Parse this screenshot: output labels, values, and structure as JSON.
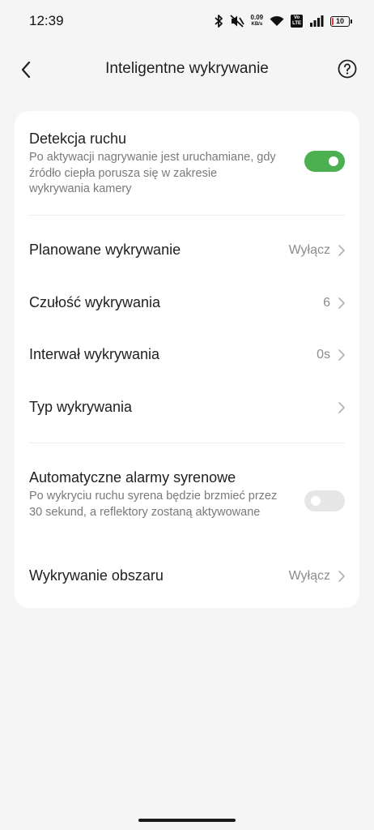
{
  "status_bar": {
    "time": "12:39",
    "net_speed": "0.09",
    "net_unit": "KB/s",
    "volte_top": "Vo",
    "volte_bottom": "LTE",
    "battery": "10",
    "battery_color": "#e53935",
    "battery_level": 0.1,
    "icons": [
      "bluetooth-icon",
      "mute-icon",
      "wifi-icon",
      "signal-icon",
      "battery-icon"
    ]
  },
  "header": {
    "title": "Inteligentne wykrywanie",
    "back_icon": "chevron-left-icon",
    "help_icon": "help-circle-icon"
  },
  "settings": {
    "motion_detection": {
      "title": "Detekcja ruchu",
      "description": "Po aktywacji nagrywanie jest uruchamiane, gdy źródło ciepła porusza się w zakresie wykrywania kamery",
      "enabled": true
    },
    "scheduled_detection": {
      "title": "Planowane wykrywanie",
      "value": "Wyłącz"
    },
    "sensitivity": {
      "title": "Czułość wykrywania",
      "value": "6"
    },
    "interval": {
      "title": "Interwał wykrywania",
      "value": "0s"
    },
    "detection_type": {
      "title": "Typ wykrywania",
      "value": ""
    },
    "siren_alarm": {
      "title": "Automatyczne alarmy syrenowe",
      "description": "Po wykryciu ruchu syrena będzie brzmieć przez 30 sekund, a reflektory zostaną aktywowane",
      "enabled": false
    },
    "area_detection": {
      "title": "Wykrywanie obszaru",
      "value": "Wyłącz"
    }
  },
  "colors": {
    "background": "#f5f5f5",
    "card": "#ffffff",
    "toggle_on": "#4caf50",
    "toggle_off": "#e6e6e6"
  }
}
